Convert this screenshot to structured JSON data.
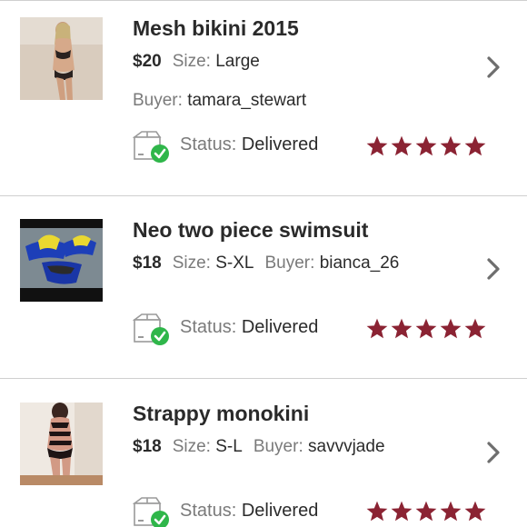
{
  "colors": {
    "star": "#8b2333",
    "check": "#2fb64a",
    "label": "#7a7a7a",
    "chevron": "#6e6e6e"
  },
  "labels": {
    "size": "Size:",
    "buyer": "Buyer:",
    "status": "Status:"
  },
  "orders": [
    {
      "title": "Mesh bikini 2015",
      "price": "$20",
      "size": "Large",
      "buyer": "tamara_stewart",
      "status": "Delivered",
      "rating": 5
    },
    {
      "title": "Neo two piece swimsuit",
      "price": "$18",
      "size": "S-XL",
      "buyer": "bianca_26",
      "status": "Delivered",
      "rating": 5
    },
    {
      "title": "Strappy monokini",
      "price": "$18",
      "size": "S-L",
      "buyer": "savvvjade",
      "status": "Delivered",
      "rating": 5
    }
  ]
}
